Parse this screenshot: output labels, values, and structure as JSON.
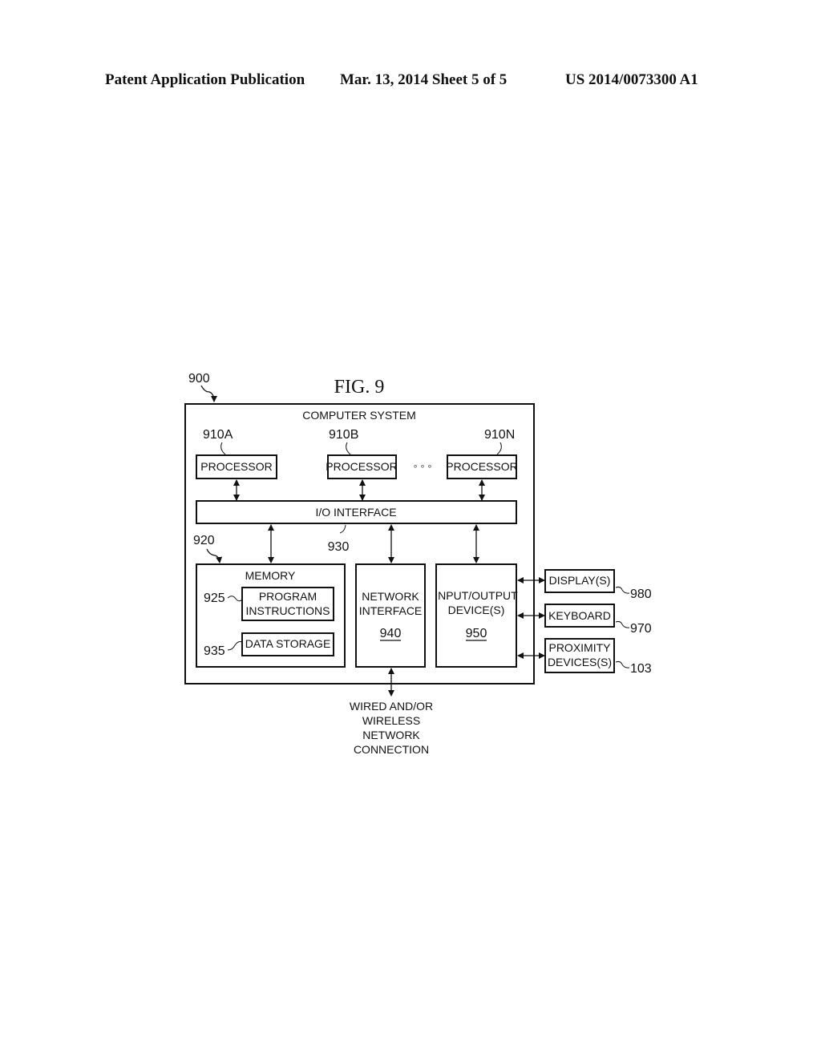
{
  "header": {
    "publication": "Patent Application Publication",
    "date_sheet": "Mar. 13, 2014  Sheet 5 of 5",
    "pub_number": "US 2014/0073300 A1"
  },
  "figure": {
    "title": "FIG. 9",
    "system_ref": "900",
    "system_label": "COMPUTER SYSTEM",
    "processors": [
      {
        "ref": "910A",
        "label": "PROCESSOR"
      },
      {
        "ref": "910B",
        "label": "PROCESSOR"
      },
      {
        "ref": "910N",
        "label": "PROCESSOR"
      }
    ],
    "ellipsis": "◦ ◦ ◦",
    "io_interface": {
      "label": "I/O INTERFACE",
      "ref": "930"
    },
    "memory": {
      "ref": "920",
      "label": "MEMORY",
      "program": {
        "ref": "925",
        "line1": "PROGRAM",
        "line2": "INSTRUCTIONS"
      },
      "storage": {
        "ref": "935",
        "label": "DATA STORAGE"
      }
    },
    "network_interface": {
      "line1": "NETWORK",
      "line2": "INTERFACE",
      "ref": "940"
    },
    "io_devices": {
      "line1": "INPUT/OUTPUT",
      "line2": "DEVICE(S)",
      "ref": "950"
    },
    "external": [
      {
        "line1": "DISPLAY(S)",
        "line2": "",
        "ref": "980"
      },
      {
        "line1": "KEYBOARD",
        "line2": "",
        "ref": "970"
      },
      {
        "line1": "PROXIMITY",
        "line2": "DEVICES(S)",
        "ref": "103"
      }
    ],
    "network_connection": [
      "WIRED AND/OR",
      "WIRELESS",
      "NETWORK",
      "CONNECTION"
    ]
  }
}
